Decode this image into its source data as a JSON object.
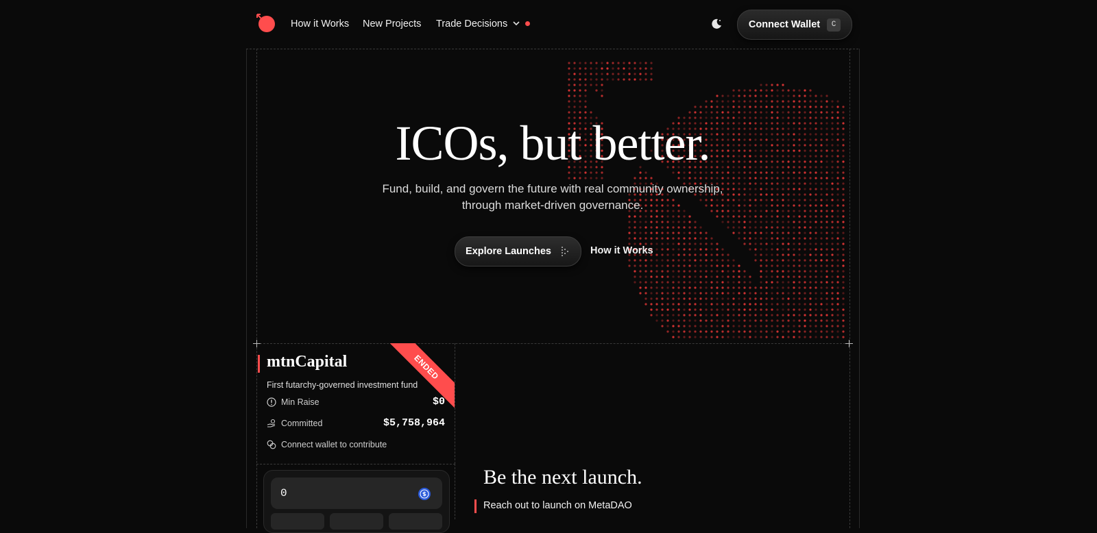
{
  "nav": {
    "links": [
      "How it Works",
      "New Projects",
      "Trade Decisions"
    ],
    "connect_wallet": "Connect Wallet",
    "shortcut": "C"
  },
  "hero": {
    "title": "ICOs, but better.",
    "subtitle_line1": "Fund, build, and govern the future with real community ownership,",
    "subtitle_line2": "through market-driven governance.",
    "explore_button": "Explore Launches",
    "how_link": "How it Works"
  },
  "project": {
    "name": "mtnCapital",
    "description": "First futarchy-governed investment fund",
    "status": "ENDED",
    "min_raise_label": "Min Raise",
    "min_raise_value": "$0",
    "committed_label": "Committed",
    "committed_value": "$5,758,964",
    "connect_hint": "Connect wallet to contribute",
    "amount_value": "0"
  },
  "next_launch": {
    "title": "Be the next launch.",
    "link": "Reach out to launch on MetaDAO"
  },
  "colors": {
    "accent": "#ff4d4d",
    "background": "#0a0a0a"
  }
}
